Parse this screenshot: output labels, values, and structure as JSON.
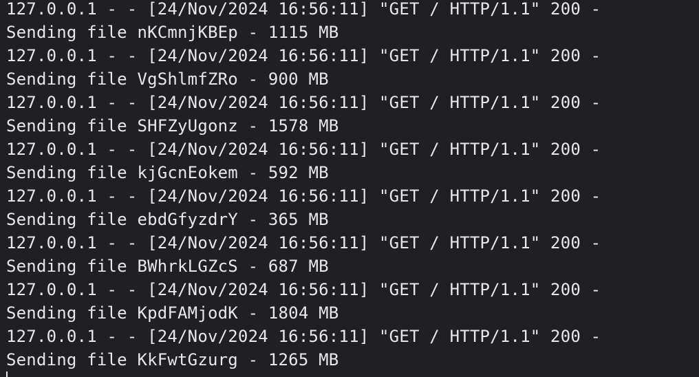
{
  "terminal": {
    "lines": [
      "127.0.0.1 - - [24/Nov/2024 16:56:11] \"GET / HTTP/1.1\" 200 -",
      "Sending file nKCmnjKBEp - 1115 MB",
      "127.0.0.1 - - [24/Nov/2024 16:56:11] \"GET / HTTP/1.1\" 200 -",
      "Sending file VgShlmfZRo - 900 MB",
      "127.0.0.1 - - [24/Nov/2024 16:56:11] \"GET / HTTP/1.1\" 200 -",
      "Sending file SHFZyUgonz - 1578 MB",
      "127.0.0.1 - - [24/Nov/2024 16:56:11] \"GET / HTTP/1.1\" 200 -",
      "Sending file kjGcnEokem - 592 MB",
      "127.0.0.1 - - [24/Nov/2024 16:56:11] \"GET / HTTP/1.1\" 200 -",
      "Sending file ebdGfyzdrY - 365 MB",
      "127.0.0.1 - - [24/Nov/2024 16:56:11] \"GET / HTTP/1.1\" 200 -",
      "Sending file BWhrkLGZcS - 687 MB",
      "127.0.0.1 - - [24/Nov/2024 16:56:11] \"GET / HTTP/1.1\" 200 -",
      "Sending file KpdFAMjodK - 1804 MB",
      "127.0.0.1 - - [24/Nov/2024 16:56:11] \"GET / HTTP/1.1\" 200 -",
      "Sending file KkFwtGzurg - 1265 MB"
    ]
  },
  "colors": {
    "background": "#1f1f24",
    "text": "#e8e8ea"
  }
}
